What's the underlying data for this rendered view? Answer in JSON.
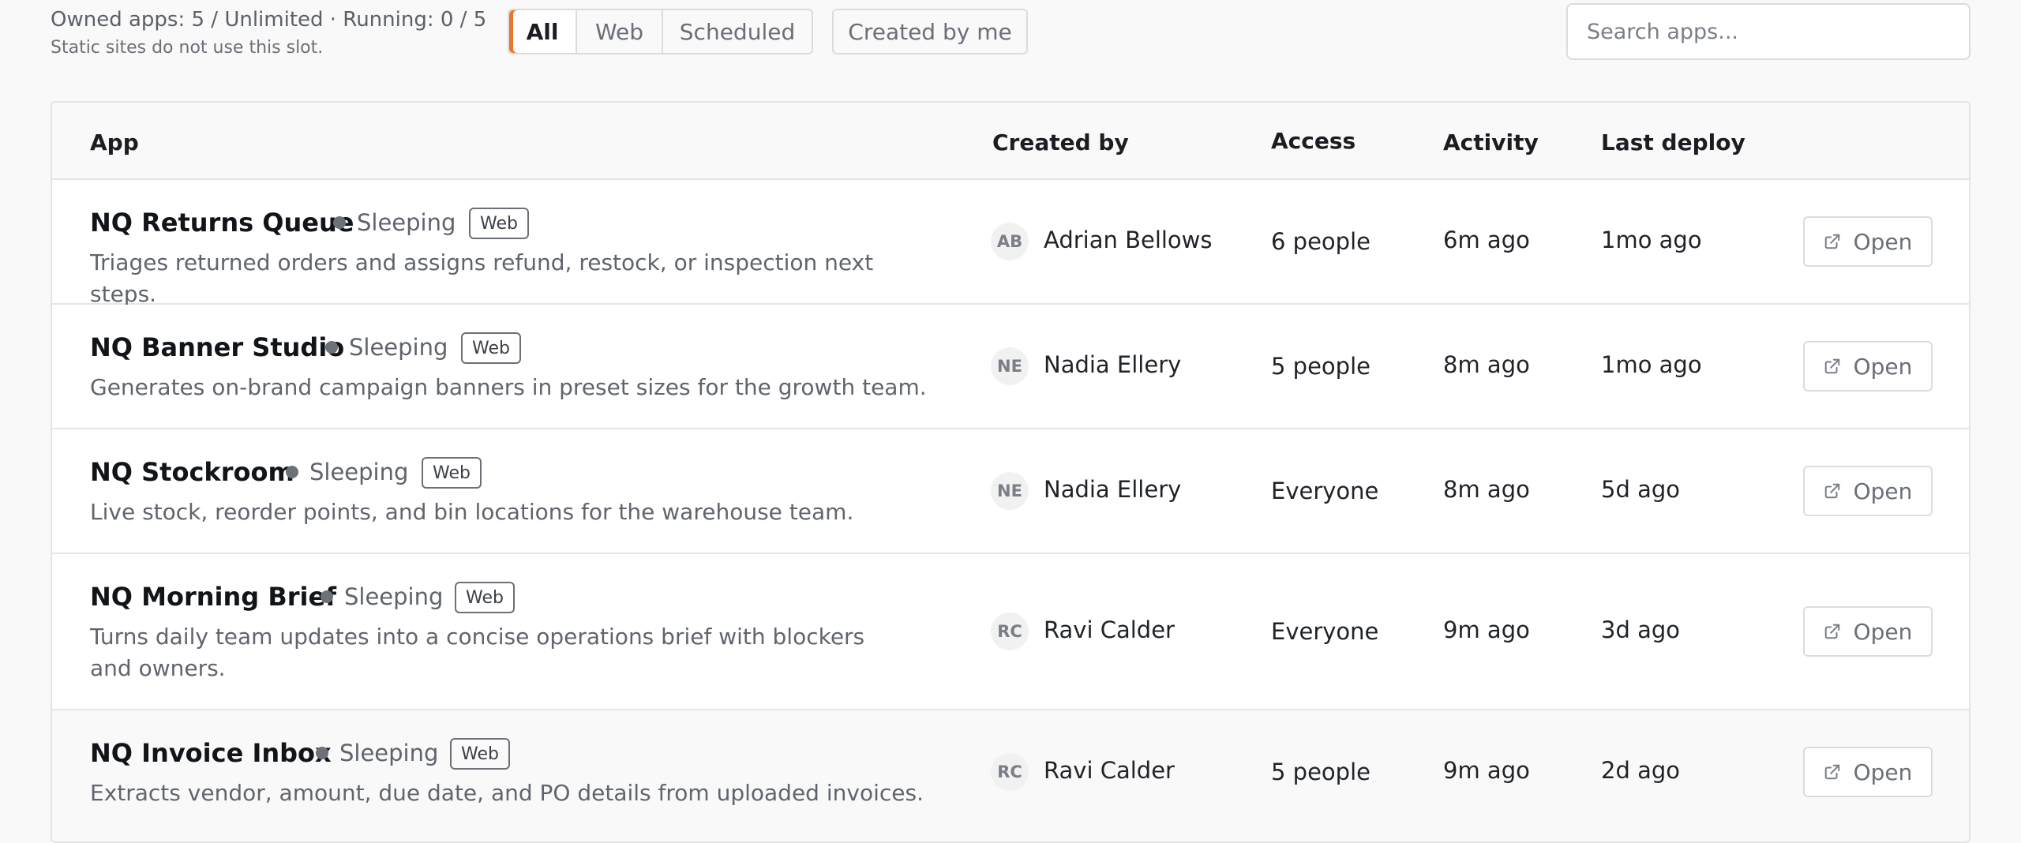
{
  "header": {
    "quota": "Owned apps: 5 / Unlimited · Running: 0 / 5",
    "quota_note": "Static sites do not use this slot.",
    "filters": [
      "All",
      "Web",
      "Scheduled"
    ],
    "active_filter": "All",
    "created_by_me": "Created by me",
    "search_placeholder": "Search apps..."
  },
  "columns": {
    "app": "App",
    "created_by": "Created by",
    "access": "Access",
    "activity": "Activity",
    "last_deploy": "Last deploy"
  },
  "colors": {
    "accent": "#e8762d",
    "status_sleeping": "#6d7178"
  },
  "icons": {
    "open": "external-link-icon",
    "status": "status-dot-icon"
  },
  "apps": [
    {
      "name": "NQ Returns Queue",
      "status": "Sleeping",
      "type": "Web",
      "description": "Triages returned orders and assigns refund, restock, or inspection next steps.",
      "creator_initials": "AB",
      "creator": "Adrian Bellows",
      "access": "6 people",
      "activity": "6m ago",
      "last_deploy": "1mo ago",
      "action": "Open"
    },
    {
      "name": "NQ Banner Studio",
      "status": "Sleeping",
      "type": "Web",
      "description": "Generates on-brand campaign banners in preset sizes for the growth team.",
      "creator_initials": "NE",
      "creator": "Nadia Ellery",
      "access": "5 people",
      "activity": "8m ago",
      "last_deploy": "1mo ago",
      "action": "Open"
    },
    {
      "name": "NQ Stockroom",
      "status": "Sleeping",
      "type": "Web",
      "description": "Live stock, reorder points, and bin locations for the warehouse team.",
      "creator_initials": "NE",
      "creator": "Nadia Ellery",
      "access": "Everyone",
      "activity": "8m ago",
      "last_deploy": "5d ago",
      "action": "Open"
    },
    {
      "name": "NQ Morning Brief",
      "status": "Sleeping",
      "type": "Web",
      "description": "Turns daily team updates into a concise operations brief with blockers and owners.",
      "creator_initials": "RC",
      "creator": "Ravi Calder",
      "access": "Everyone",
      "activity": "9m ago",
      "last_deploy": "3d ago",
      "action": "Open"
    },
    {
      "name": "NQ Invoice Inbox",
      "status": "Sleeping",
      "type": "Web",
      "description": "Extracts vendor, amount, due date, and PO details from uploaded invoices.",
      "creator_initials": "RC",
      "creator": "Ravi Calder",
      "access": "5 people",
      "activity": "9m ago",
      "last_deploy": "2d ago",
      "action": "Open"
    }
  ]
}
